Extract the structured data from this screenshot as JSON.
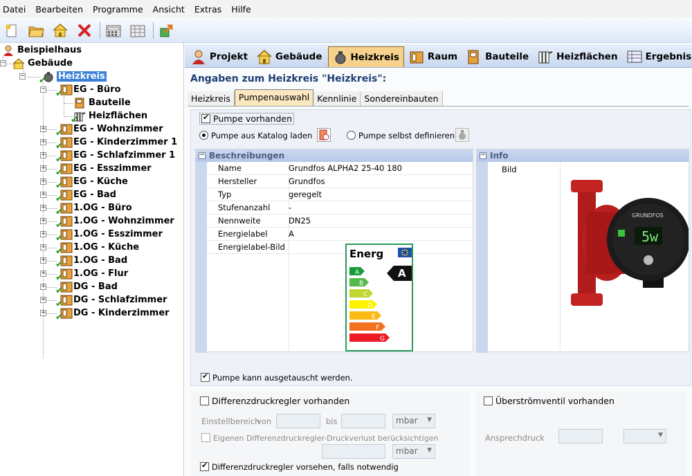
{
  "menu": [
    "Datei",
    "Bearbeiten",
    "Programme",
    "Ansicht",
    "Extras",
    "Hilfe"
  ],
  "toolbar": [
    "new-icon",
    "open-icon",
    "house-icon",
    "delete-icon",
    "calculator-icon",
    "table-icon",
    "export-icon"
  ],
  "tree": {
    "root": "Beispielhaus",
    "building": "Gebäude",
    "circuit": "Heizkreis",
    "rooms": [
      {
        "label": "EG - Büro",
        "children": [
          "Bauteile",
          "Heizflächen"
        ]
      },
      {
        "label": "EG - Wohnzimmer"
      },
      {
        "label": "EG - Kinderzimmer 1"
      },
      {
        "label": "EG - Schlafzimmer 1"
      },
      {
        "label": "EG - Esszimmer"
      },
      {
        "label": "EG - Küche"
      },
      {
        "label": "EG - Bad"
      },
      {
        "label": "1.OG - Büro"
      },
      {
        "label": "1.OG - Wohnzimmer"
      },
      {
        "label": "1.OG - Esszimmer"
      },
      {
        "label": "1.OG - Küche"
      },
      {
        "label": "1.OG - Bad"
      },
      {
        "label": "1.OG - Flur"
      },
      {
        "label": "DG - Bad"
      },
      {
        "label": "DG - Schlafzimmer"
      },
      {
        "label": "DG - Kinderzimmer"
      }
    ]
  },
  "tabs": [
    {
      "label": "Projekt",
      "icon": "person-icon"
    },
    {
      "label": "Gebäude",
      "icon": "house-icon"
    },
    {
      "label": "Heizkreis",
      "icon": "pump-icon"
    },
    {
      "label": "Raum",
      "icon": "room-icon"
    },
    {
      "label": "Bauteile",
      "icon": "wall-icon"
    },
    {
      "label": "Heizflächen",
      "icon": "radiator-icon"
    },
    {
      "label": "Ergebnis",
      "icon": "result-table-icon"
    }
  ],
  "heading": "Angaben zum Heizkreis \"Heizkreis\":",
  "subtabs": [
    "Heizkreis",
    "Pumpenauswahl",
    "Kennlinie",
    "Sondereinbauten"
  ],
  "pump": {
    "present_label": "Pumpe vorhanden",
    "catalog_label": "Pumpe aus Katalog laden",
    "custom_label": "Pumpe selbst definieren",
    "desc_header": "Beschreibungen",
    "info_header": "Info",
    "info_image_label": "Bild",
    "rows": [
      {
        "k": "Name",
        "v": "Grundfos ALPHA2 25-40 180"
      },
      {
        "k": "Hersteller",
        "v": "Grundfos"
      },
      {
        "k": "Typ",
        "v": "geregelt"
      },
      {
        "k": "Stufenanzahl",
        "v": "-"
      },
      {
        "k": "Nennweite",
        "v": "DN25"
      },
      {
        "k": "Energielabel",
        "v": "A"
      },
      {
        "k": "Energielabel-Bild",
        "v": ""
      }
    ],
    "energy_label": {
      "title": "Energ",
      "rating": "A",
      "classes": [
        "A",
        "B",
        "C",
        "D",
        "E",
        "F",
        "G"
      ],
      "colors": [
        "#1a9b3a",
        "#54b948",
        "#bfd730",
        "#fff200",
        "#fdb913",
        "#f37021",
        "#ed1c24"
      ]
    },
    "pump_display": "5w",
    "pump_brand": "GRUNDFOS",
    "exchange_label": "Pumpe kann ausgetauscht werden."
  },
  "diff": {
    "present_label": "Differenzdruckregler vorhanden",
    "range_label": "Einstellbereich",
    "from_label": "von",
    "to_label": "bis",
    "unit1": "mbar",
    "own_loss_label": "Eigenen Differenzdruckregler-Druckverlust berücksichtigen",
    "unit2": "mbar",
    "provide_label": "Differenzdruckregler vorsehen, falls notwendig"
  },
  "overflow": {
    "present_label": "Überströmventil vorhanden",
    "pressure_label": "Ansprechdruck"
  }
}
